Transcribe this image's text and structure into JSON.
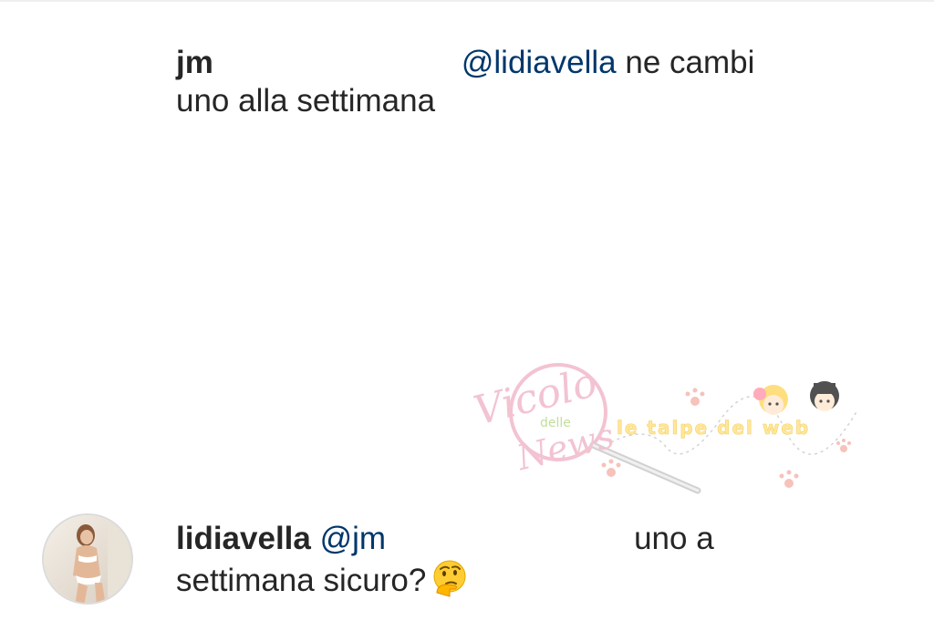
{
  "comments": [
    {
      "username": "jm",
      "mention": "@lidiavella",
      "text_inline": "ne cambi",
      "text_wrap": "uno alla settimana"
    },
    {
      "username": "lidiavella",
      "mention": "@jm",
      "text_inline": "uno a",
      "text_wrap": "settimana sicuro?",
      "emoji": "thinking-face-emoji"
    }
  ],
  "watermark": {
    "brand_top": "Vicolo",
    "brand_mid": "delle",
    "brand_bottom": "News",
    "tagline": "le talpe del web"
  },
  "colors": {
    "text": "#262626",
    "mention": "#00376b",
    "watermark_pink": "#f1b9c9",
    "watermark_yellow": "#ffe38a"
  }
}
